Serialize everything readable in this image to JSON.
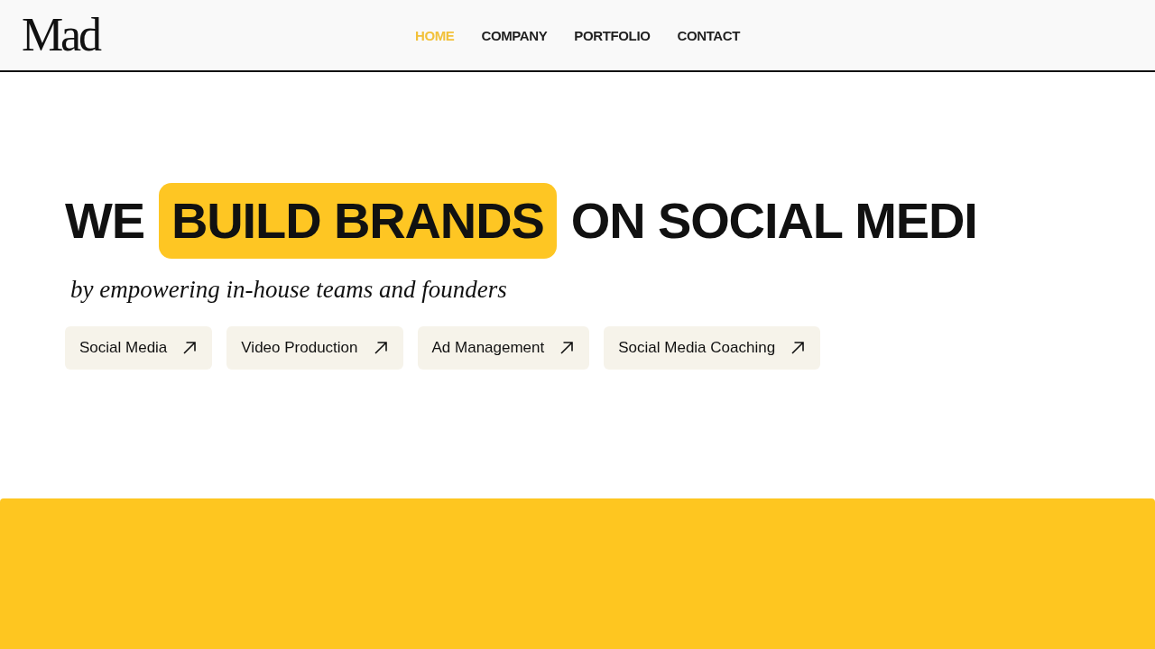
{
  "header": {
    "logo": "Mad",
    "nav": [
      {
        "label": "HOME",
        "selected": true
      },
      {
        "label": "COMPANY",
        "selected": false
      },
      {
        "label": "PORTFOLIO",
        "selected": false
      },
      {
        "label": "CONTACT",
        "selected": false
      }
    ]
  },
  "hero": {
    "headline": {
      "before": "WE",
      "highlight": "BUILD BRANDS",
      "after": "ON SOCIAL MEDI"
    },
    "tagline": "by empowering in-house teams and founders",
    "services": [
      "Social Media",
      "Video Production",
      "Ad Management",
      "Social Media Coaching"
    ]
  }
}
